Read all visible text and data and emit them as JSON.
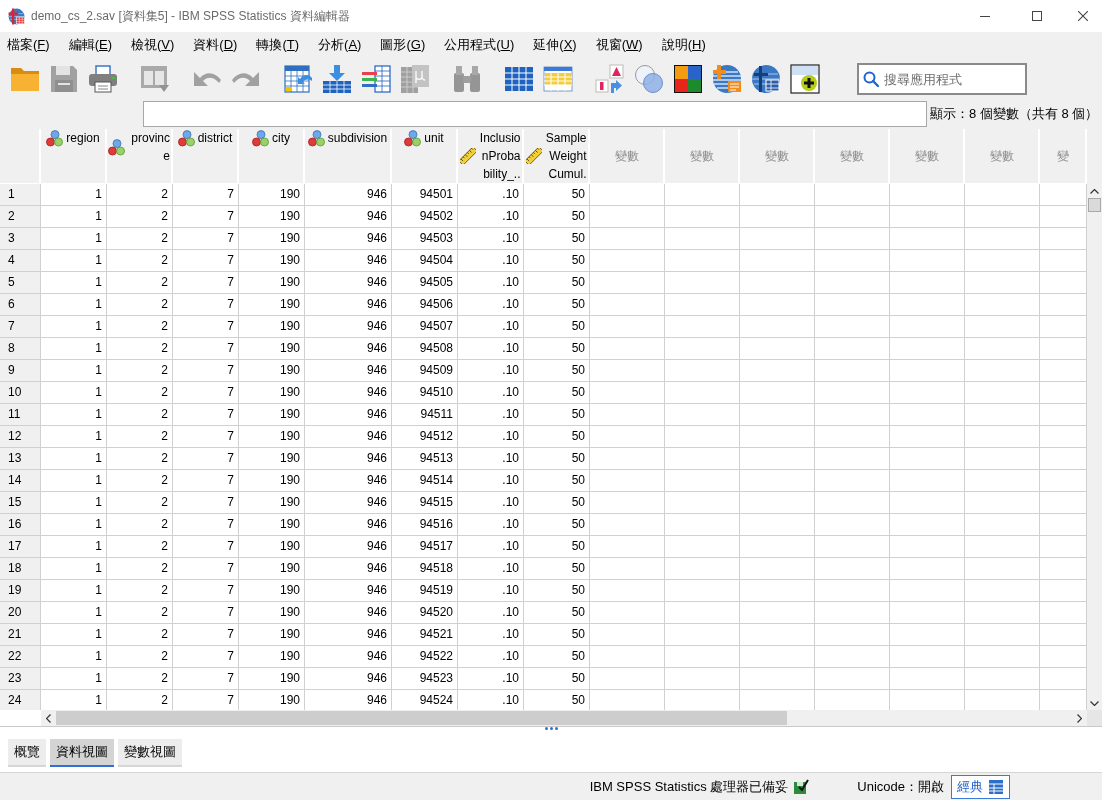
{
  "window": {
    "title": "demo_cs_2.sav [資料集5] - IBM SPSS Statistics 資料編輯器"
  },
  "menu": [
    "檔案(F)",
    "編輯(E)",
    "檢視(V)",
    "資料(D)",
    "轉換(T)",
    "分析(A)",
    "圖形(G)",
    "公用程式(U)",
    "延伸(X)",
    "視窗(W)",
    "說明(H)"
  ],
  "toolbar": [
    {
      "buttons": [
        {
          "kind": "folder",
          "disabled": false
        },
        {
          "kind": "floppy",
          "disabled": true
        },
        {
          "kind": "printer",
          "disabled": false
        }
      ]
    },
    {
      "buttons": [
        {
          "kind": "window_arrow",
          "disabled": true
        }
      ]
    },
    {
      "buttons": [
        {
          "kind": "undo",
          "disabled": true
        },
        {
          "kind": "redo",
          "disabled": true
        }
      ]
    },
    {
      "buttons": [
        {
          "kind": "table_arrow",
          "disabled": false
        },
        {
          "kind": "grid_down_arrow",
          "disabled": false
        },
        {
          "kind": "striped_grid",
          "disabled": false
        },
        {
          "kind": "grid_page",
          "disabled": true
        }
      ]
    },
    {
      "buttons": [
        {
          "kind": "binoculars",
          "disabled": true
        }
      ]
    },
    {
      "buttons": [
        {
          "kind": "grid",
          "disabled": false
        },
        {
          "kind": "table",
          "disabled": false
        }
      ]
    },
    {
      "buttons": [
        {
          "kind": "split_arrows",
          "disabled": false
        },
        {
          "kind": "circles",
          "disabled": false
        },
        {
          "kind": "squares",
          "disabled": false
        },
        {
          "kind": "globe_plus",
          "disabled": false
        },
        {
          "kind": "globe_table",
          "disabled": false
        },
        {
          "kind": "window_plus",
          "disabled": false
        }
      ]
    }
  ],
  "search": {
    "placeholder": "搜尋應用程式"
  },
  "variable_count": "顯示：8 個變數（共有 8 個）",
  "grid": {
    "columns": [
      {
        "name": "region",
        "kind": "nominal"
      },
      {
        "name": "province",
        "kind": "nominal"
      },
      {
        "name": "district",
        "kind": "nominal"
      },
      {
        "name": "city",
        "kind": "nominal"
      },
      {
        "name": "subdivision",
        "kind": "nominal"
      },
      {
        "name": "unit",
        "kind": "nominal"
      },
      {
        "name": "InclusionProbability_..",
        "kind": "scale"
      },
      {
        "name": "SampleWeightCumul.",
        "kind": "scale"
      },
      {
        "name": "變數",
        "kind": "empty"
      },
      {
        "name": "變數",
        "kind": "empty"
      },
      {
        "name": "變數",
        "kind": "empty"
      },
      {
        "name": "變數",
        "kind": "empty"
      },
      {
        "name": "變數",
        "kind": "empty"
      },
      {
        "name": "變數",
        "kind": "empty"
      },
      {
        "name": "變",
        "kind": "empty"
      }
    ],
    "rows": [
      {
        "number": "1",
        "cells": [
          "1",
          "2",
          "7",
          "190",
          "946",
          "94501",
          ".10",
          "50"
        ]
      },
      {
        "number": "2",
        "cells": [
          "1",
          "2",
          "7",
          "190",
          "946",
          "94502",
          ".10",
          "50"
        ]
      },
      {
        "number": "3",
        "cells": [
          "1",
          "2",
          "7",
          "190",
          "946",
          "94503",
          ".10",
          "50"
        ]
      },
      {
        "number": "4",
        "cells": [
          "1",
          "2",
          "7",
          "190",
          "946",
          "94504",
          ".10",
          "50"
        ]
      },
      {
        "number": "5",
        "cells": [
          "1",
          "2",
          "7",
          "190",
          "946",
          "94505",
          ".10",
          "50"
        ]
      },
      {
        "number": "6",
        "cells": [
          "1",
          "2",
          "7",
          "190",
          "946",
          "94506",
          ".10",
          "50"
        ]
      },
      {
        "number": "7",
        "cells": [
          "1",
          "2",
          "7",
          "190",
          "946",
          "94507",
          ".10",
          "50"
        ]
      },
      {
        "number": "8",
        "cells": [
          "1",
          "2",
          "7",
          "190",
          "946",
          "94508",
          ".10",
          "50"
        ]
      },
      {
        "number": "9",
        "cells": [
          "1",
          "2",
          "7",
          "190",
          "946",
          "94509",
          ".10",
          "50"
        ]
      },
      {
        "number": "10",
        "cells": [
          "1",
          "2",
          "7",
          "190",
          "946",
          "94510",
          ".10",
          "50"
        ]
      },
      {
        "number": "11",
        "cells": [
          "1",
          "2",
          "7",
          "190",
          "946",
          "94511",
          ".10",
          "50"
        ]
      },
      {
        "number": "12",
        "cells": [
          "1",
          "2",
          "7",
          "190",
          "946",
          "94512",
          ".10",
          "50"
        ]
      },
      {
        "number": "13",
        "cells": [
          "1",
          "2",
          "7",
          "190",
          "946",
          "94513",
          ".10",
          "50"
        ]
      },
      {
        "number": "14",
        "cells": [
          "1",
          "2",
          "7",
          "190",
          "946",
          "94514",
          ".10",
          "50"
        ]
      },
      {
        "number": "15",
        "cells": [
          "1",
          "2",
          "7",
          "190",
          "946",
          "94515",
          ".10",
          "50"
        ]
      },
      {
        "number": "16",
        "cells": [
          "1",
          "2",
          "7",
          "190",
          "946",
          "94516",
          ".10",
          "50"
        ]
      },
      {
        "number": "17",
        "cells": [
          "1",
          "2",
          "7",
          "190",
          "946",
          "94517",
          ".10",
          "50"
        ]
      },
      {
        "number": "18",
        "cells": [
          "1",
          "2",
          "7",
          "190",
          "946",
          "94518",
          ".10",
          "50"
        ]
      },
      {
        "number": "19",
        "cells": [
          "1",
          "2",
          "7",
          "190",
          "946",
          "94519",
          ".10",
          "50"
        ]
      },
      {
        "number": "20",
        "cells": [
          "1",
          "2",
          "7",
          "190",
          "946",
          "94520",
          ".10",
          "50"
        ]
      },
      {
        "number": "21",
        "cells": [
          "1",
          "2",
          "7",
          "190",
          "946",
          "94521",
          ".10",
          "50"
        ]
      },
      {
        "number": "22",
        "cells": [
          "1",
          "2",
          "7",
          "190",
          "946",
          "94522",
          ".10",
          "50"
        ]
      },
      {
        "number": "23",
        "cells": [
          "1",
          "2",
          "7",
          "190",
          "946",
          "94523",
          ".10",
          "50"
        ]
      },
      {
        "number": "24",
        "cells": [
          "1",
          "2",
          "7",
          "190",
          "946",
          "94524",
          ".10",
          "50"
        ]
      }
    ]
  },
  "view_tabs": [
    {
      "label": "概覽",
      "selected": false
    },
    {
      "label": "資料視圖",
      "selected": true
    },
    {
      "label": "變數視圖",
      "selected": false
    }
  ],
  "status_bar": {
    "processor": "IBM SPSS Statistics 處理器已備妥",
    "unicode": "Unicode：開啟",
    "mode_button": "經典"
  }
}
